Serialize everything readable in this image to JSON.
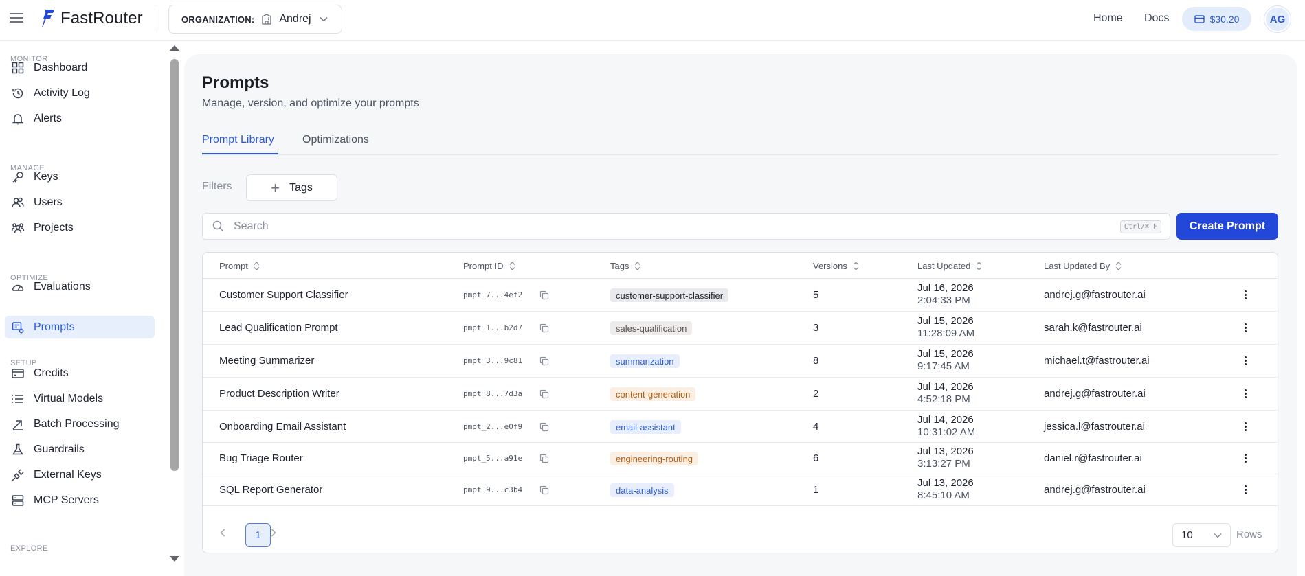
{
  "brand": {
    "name": "FastRouter"
  },
  "org": {
    "label": "ORGANIZATION:",
    "name": "Andrej"
  },
  "topnav": {
    "home": "Home",
    "docs": "Docs",
    "credits": "$30.20",
    "avatar": "AG"
  },
  "sidebar": {
    "sections": [
      {
        "title": "MONITOR",
        "items": [
          {
            "label": "Dashboard",
            "icon": "grid-icon"
          },
          {
            "label": "Activity Log",
            "icon": "history-icon"
          },
          {
            "label": "Alerts",
            "icon": "bell-icon"
          }
        ]
      },
      {
        "title": "MANAGE",
        "items": [
          {
            "label": "Keys",
            "icon": "key-icon"
          },
          {
            "label": "Users",
            "icon": "users-icon"
          },
          {
            "label": "Projects",
            "icon": "projects-icon"
          }
        ]
      },
      {
        "title": "OPTIMIZE",
        "items": [
          {
            "label": "Evaluations",
            "icon": "gauge-icon"
          },
          {
            "label": "Prompts",
            "icon": "prompt-icon",
            "active": true
          }
        ]
      },
      {
        "title": "SETUP",
        "items": [
          {
            "label": "Credits",
            "icon": "wallet-icon"
          },
          {
            "label": "Virtual Models",
            "icon": "list-icon"
          },
          {
            "label": "Batch Processing",
            "icon": "batch-icon"
          },
          {
            "label": "Guardrails",
            "icon": "flask-icon"
          },
          {
            "label": "External Keys",
            "icon": "plug-icon"
          },
          {
            "label": "MCP Servers",
            "icon": "server-icon"
          }
        ]
      },
      {
        "title": "EXPLORE",
        "items": []
      }
    ]
  },
  "page": {
    "title": "Prompts",
    "subtitle": "Manage, version, and optimize your prompts",
    "tabs": [
      "Prompt Library",
      "Optimizations"
    ],
    "active_tab": 0,
    "filters_label": "Filters",
    "tags_button": "Tags",
    "search_placeholder": "Search",
    "search_shortcut": "Ctrl/⌘ F",
    "create_button": "Create Prompt"
  },
  "table": {
    "columns": [
      "Prompt",
      "Prompt ID",
      "Tags",
      "Versions",
      "Last Updated",
      "Last Updated By"
    ],
    "rows": [
      {
        "prompt": "Customer Support Classifier",
        "id": "pmpt_7...4ef2",
        "tag": "customer-support-classifier",
        "tag_color": "#e9eaee",
        "tag_text": "#1f2430",
        "versions": "5",
        "date": "Jul 16, 2026",
        "time": "2:04:33 PM",
        "by": "andrej.g@fastrouter.ai"
      },
      {
        "prompt": "Lead Qualification Prompt",
        "id": "pmpt_1...b2d7",
        "tag": "sales-qualification",
        "tag_color": "#eeeceb",
        "tag_text": "#5b5450",
        "versions": "3",
        "date": "Jul 15, 2026",
        "time": "11:28:09 AM",
        "by": "sarah.k@fastrouter.ai"
      },
      {
        "prompt": "Meeting Summarizer",
        "id": "pmpt_3...9c81",
        "tag": "summarization",
        "tag_color": "#e8eefb",
        "tag_text": "#2d5bd3",
        "versions": "8",
        "date": "Jul 15, 2026",
        "time": "9:17:45 AM",
        "by": "michael.t@fastrouter.ai"
      },
      {
        "prompt": "Product Description Writer",
        "id": "pmpt_8...7d3a",
        "tag": "content-generation",
        "tag_color": "#fbefe4",
        "tag_text": "#b35c12",
        "versions": "2",
        "date": "Jul 14, 2026",
        "time": "4:52:18 PM",
        "by": "andrej.g@fastrouter.ai"
      },
      {
        "prompt": "Onboarding Email Assistant",
        "id": "pmpt_2...e0f9",
        "tag": "email-assistant",
        "tag_color": "#e8eefb",
        "tag_text": "#2d5bd3",
        "versions": "4",
        "date": "Jul 14, 2026",
        "time": "10:31:02 AM",
        "by": "jessica.l@fastrouter.ai"
      },
      {
        "prompt": "Bug Triage Router",
        "id": "pmpt_5...a91e",
        "tag": "engineering-routing",
        "tag_color": "#fbefe4",
        "tag_text": "#b35c12",
        "versions": "6",
        "date": "Jul 13, 2026",
        "time": "3:13:27 PM",
        "by": "daniel.r@fastrouter.ai"
      },
      {
        "prompt": "SQL Report Generator",
        "id": "pmpt_9...c3b4",
        "tag": "data-analysis",
        "tag_color": "#e8eefb",
        "tag_text": "#2d5bd3",
        "versions": "1",
        "date": "Jul 13, 2026",
        "time": "8:45:10 AM",
        "by": "andrej.g@fastrouter.ai"
      }
    ]
  },
  "pagination": {
    "current_page": "1",
    "rows_per_page": "10",
    "rows_label": "Rows"
  },
  "colors": {
    "accent": "#2347d9",
    "active_bg": "#e8effc",
    "panel_bg": "#f6f7f9"
  }
}
